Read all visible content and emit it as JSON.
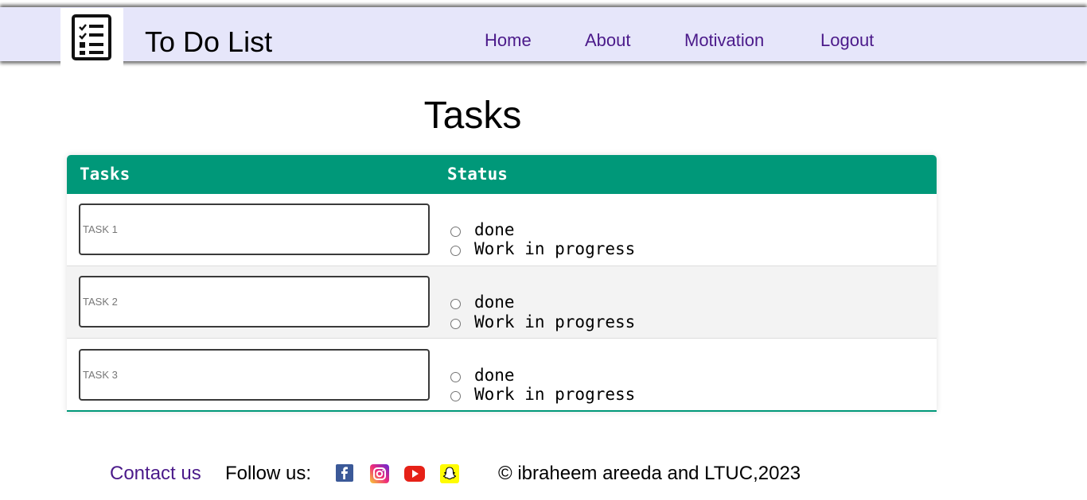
{
  "header": {
    "logo_icon": "checklist-icon",
    "title": "To Do List",
    "nav": [
      {
        "label": "Home"
      },
      {
        "label": "About"
      },
      {
        "label": "Motivation"
      },
      {
        "label": "Logout"
      }
    ]
  },
  "main": {
    "title": "Tasks",
    "table": {
      "columns": [
        "Tasks",
        "Status"
      ],
      "rows": [
        {
          "placeholder": "TASK 1",
          "value": "",
          "options": [
            "done",
            "Work in progress"
          ]
        },
        {
          "placeholder": "TASK 2",
          "value": "",
          "options": [
            "done",
            "Work in progress"
          ]
        },
        {
          "placeholder": "TASK 3",
          "value": "",
          "options": [
            "done",
            "Work in progress"
          ]
        }
      ]
    }
  },
  "footer": {
    "contact_label": "Contact us",
    "follow_label": "Follow us:",
    "social": [
      "facebook-icon",
      "instagram-icon",
      "youtube-icon",
      "snapchat-icon"
    ],
    "copyright": "© ibraheem areeda and LTUC,2023"
  },
  "colors": {
    "header_bg": "#e6e6fa",
    "nav_link": "#4b1a8a",
    "table_header": "#009879",
    "row_alt": "#f3f3f3"
  }
}
